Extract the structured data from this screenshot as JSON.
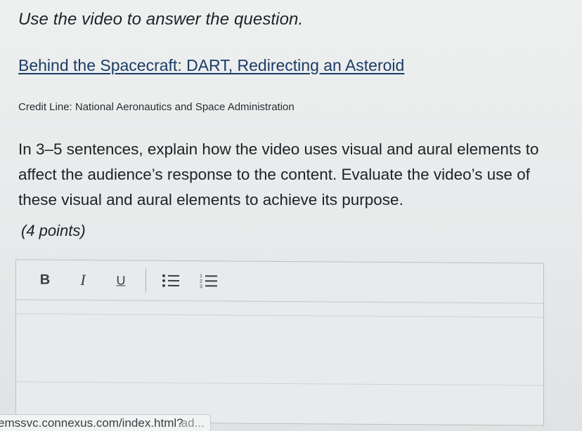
{
  "question": {
    "instruction": "Use the video to answer the question.",
    "video_title": "Behind the Spacecraft: DART, Redirecting an Asteroid",
    "credit_line": "Credit Line: National Aeronautics and Space Administration",
    "prompt": "In 3–5 sentences, explain how the video uses visual and aural elements to affect the audience’s response to the content. Evaluate the video’s use of these visual and aural elements to achieve its purpose.",
    "points": "(4 points)"
  },
  "editor": {
    "toolbar": {
      "bold_label": "B",
      "italic_label": "I",
      "underline_label": "U"
    },
    "icons": {
      "bullet_list": "bullet-list-icon",
      "numbered_list": "numbered-list-icon"
    },
    "answer_text": ""
  },
  "status_bar": {
    "url": "emssvc.connexus.com/index.html?",
    "url_fade": "ad..."
  }
}
